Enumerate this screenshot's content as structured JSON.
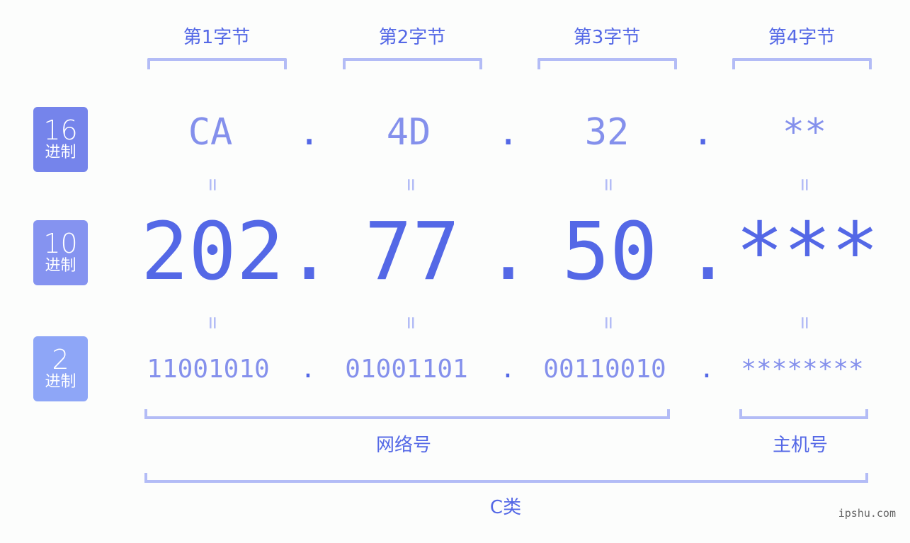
{
  "bytes": [
    {
      "label": "第1字节",
      "hex": "CA",
      "dec": "202",
      "bin": "11001010"
    },
    {
      "label": "第2字节",
      "hex": "4D",
      "dec": "77",
      "bin": "01001101"
    },
    {
      "label": "第3字节",
      "hex": "32",
      "dec": "50",
      "bin": "00110010"
    },
    {
      "label": "第4字节",
      "hex": "**",
      "dec": "***",
      "bin": "********"
    }
  ],
  "separator": ".",
  "equals": "=",
  "bases": [
    {
      "num": "16",
      "unit": "进制",
      "color": "#7584eb"
    },
    {
      "num": "10",
      "unit": "进制",
      "color": "#8593f0"
    },
    {
      "num": "2",
      "unit": "进制",
      "color": "#8ea6f7"
    }
  ],
  "segments": {
    "network": "网络号",
    "host": "主机号",
    "class": "C类"
  },
  "colors": {
    "primary": "#5468e6",
    "light": "#8490ec",
    "bracket": "#b3bcf6"
  },
  "watermark": "ipshu.com"
}
